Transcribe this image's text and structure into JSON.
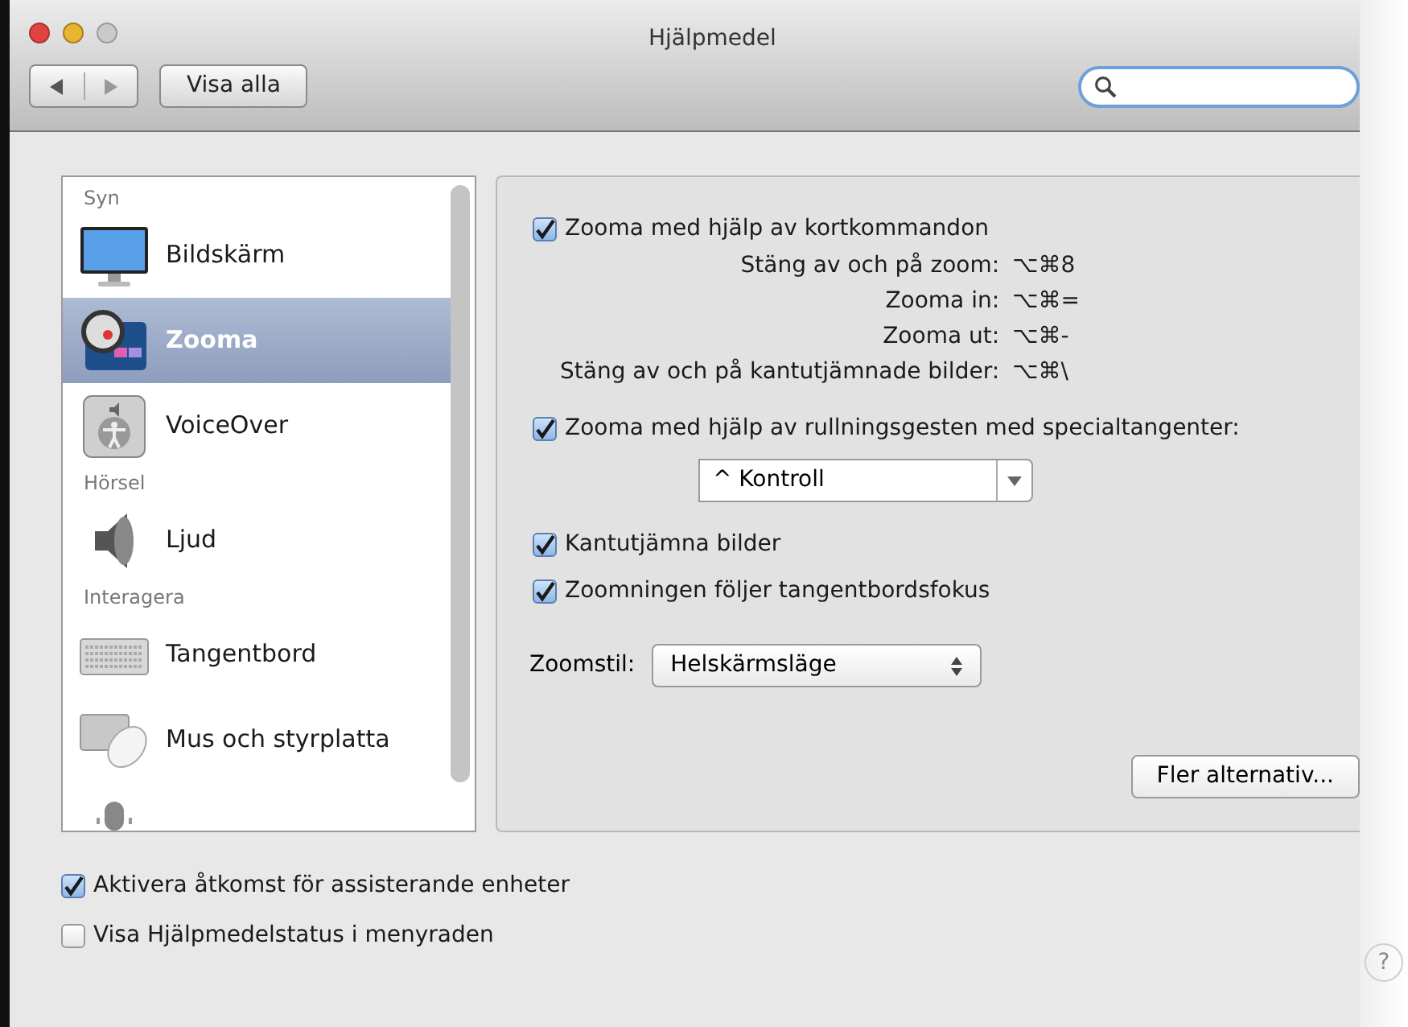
{
  "window": {
    "title": "Hjälpmedel"
  },
  "toolbar": {
    "show_all_button": "Visa alla",
    "search": {
      "focused": true
    }
  },
  "sidebar": {
    "items": [
      {
        "kind": "header",
        "label": "Syn"
      },
      {
        "kind": "item",
        "label": "Bildskärm",
        "selected": false
      },
      {
        "kind": "item",
        "label": "Zooma",
        "selected": true
      },
      {
        "kind": "item",
        "label": "VoiceOver",
        "selected": false
      },
      {
        "kind": "header",
        "label": "Hörsel"
      },
      {
        "kind": "item",
        "label": "Ljud",
        "selected": false
      },
      {
        "kind": "header",
        "label": "Interagera"
      },
      {
        "kind": "item",
        "label": "Tangentbord",
        "selected": false
      },
      {
        "kind": "item",
        "label": "Mus och styrplatta",
        "selected": false
      },
      {
        "kind": "cut_off_item"
      }
    ]
  },
  "zoom_panel": {
    "keyboard_shortcuts": {
      "label": "Zooma med hjälp av kortkommandon",
      "checked": true,
      "shortcuts": [
        {
          "label": "Stäng av och på zoom:",
          "keys": "⌥⌘8"
        },
        {
          "label": "Zooma in:",
          "keys": "⌥⌘="
        },
        {
          "label": "Zooma ut:",
          "keys": "⌥⌘-"
        },
        {
          "label": "Stäng av och på kantutjämnade bilder:",
          "keys": "⌥⌘\\"
        }
      ]
    },
    "scroll_gesture": {
      "label": "Zooma med hjälp av rullningsgesten med specialtangenter:",
      "checked": true,
      "modifier": "^ Kontroll"
    },
    "options": [
      {
        "label": "Kantutjämna bilder",
        "checked": true
      },
      {
        "label": "Zoomningen följer tangentbordsfokus",
        "checked": true
      }
    ],
    "zoom_style": {
      "label": "Zoomstil:",
      "value": "Helskärmsläge"
    },
    "more_options_button": "Fler alternativ..."
  },
  "bottom_options": [
    {
      "label": "Aktivera åtkomst för assisterande enheter",
      "checked": true
    },
    {
      "label": "Visa Hjälpmedelstatus i menyraden",
      "checked": false
    }
  ],
  "help_button": "?"
}
